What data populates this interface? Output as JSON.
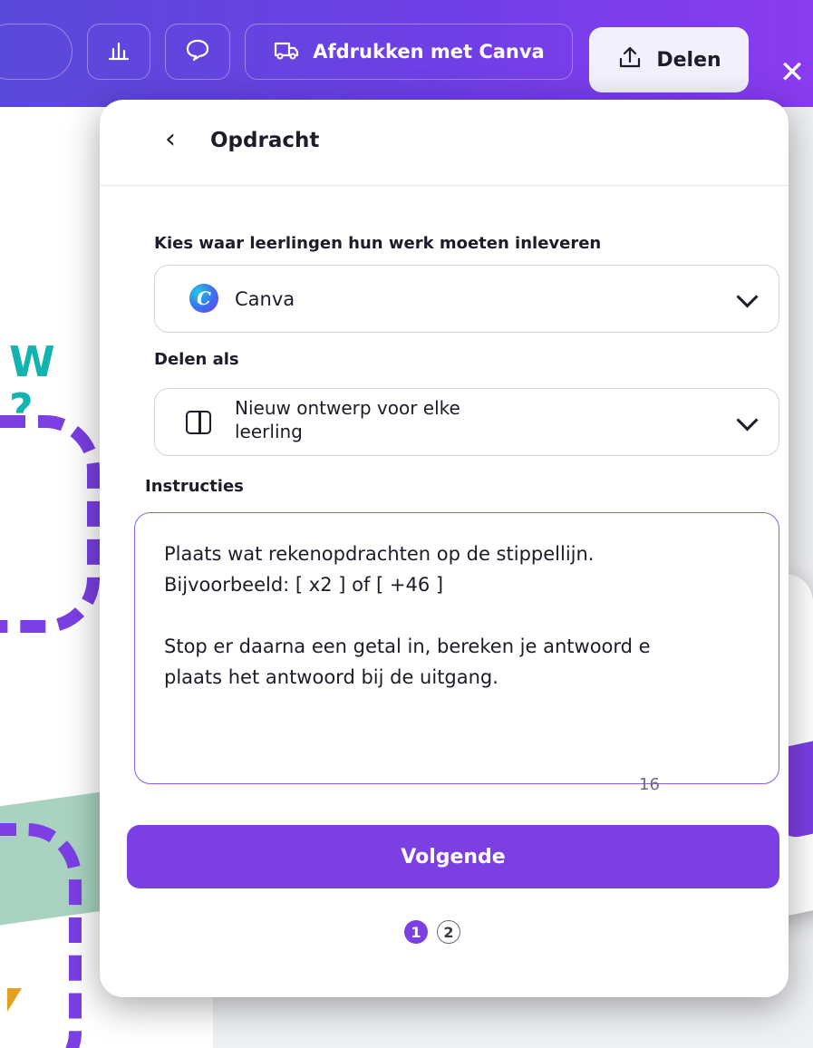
{
  "toolbar": {
    "print_label": "Afdrukken met Canva",
    "share_label": "Delen",
    "close_glyph": "✕",
    "icons": [
      "poll-icon",
      "comment-icon",
      "truck-icon",
      "upload-icon",
      "close-icon"
    ]
  },
  "canvas": {
    "bubble_text_line1": "W",
    "bubble_text_line2": "?"
  },
  "panel": {
    "back_glyph": "‹",
    "title": "Opdracht",
    "submit_label": "Kies waar leerlingen hun werk moeten inleveren",
    "submit_value": "Canva",
    "share_as_label": "Delen als",
    "share_as_value": "Nieuw ontwerp voor elke leerling",
    "instructions_label": "Instructies",
    "instructions_value": "Plaats wat rekenopdrachten op de stippellijn.\nBijvoorbeeld: [ x2 ] of [ +46 ]\n\nStop er daarna een getal in, bereken je antwoord e\nplaats het antwoord bij de uitgang.",
    "char_counter": "16",
    "next_button": "Volgende",
    "steps": [
      "1",
      "2"
    ],
    "active_step": 1
  },
  "colors": {
    "accent": "#7b3fe4",
    "toolbar_start": "#5a49d9",
    "toolbar_end": "#8a3bef",
    "teal": "#13b3b0",
    "green_band": "#a9d3c0"
  }
}
